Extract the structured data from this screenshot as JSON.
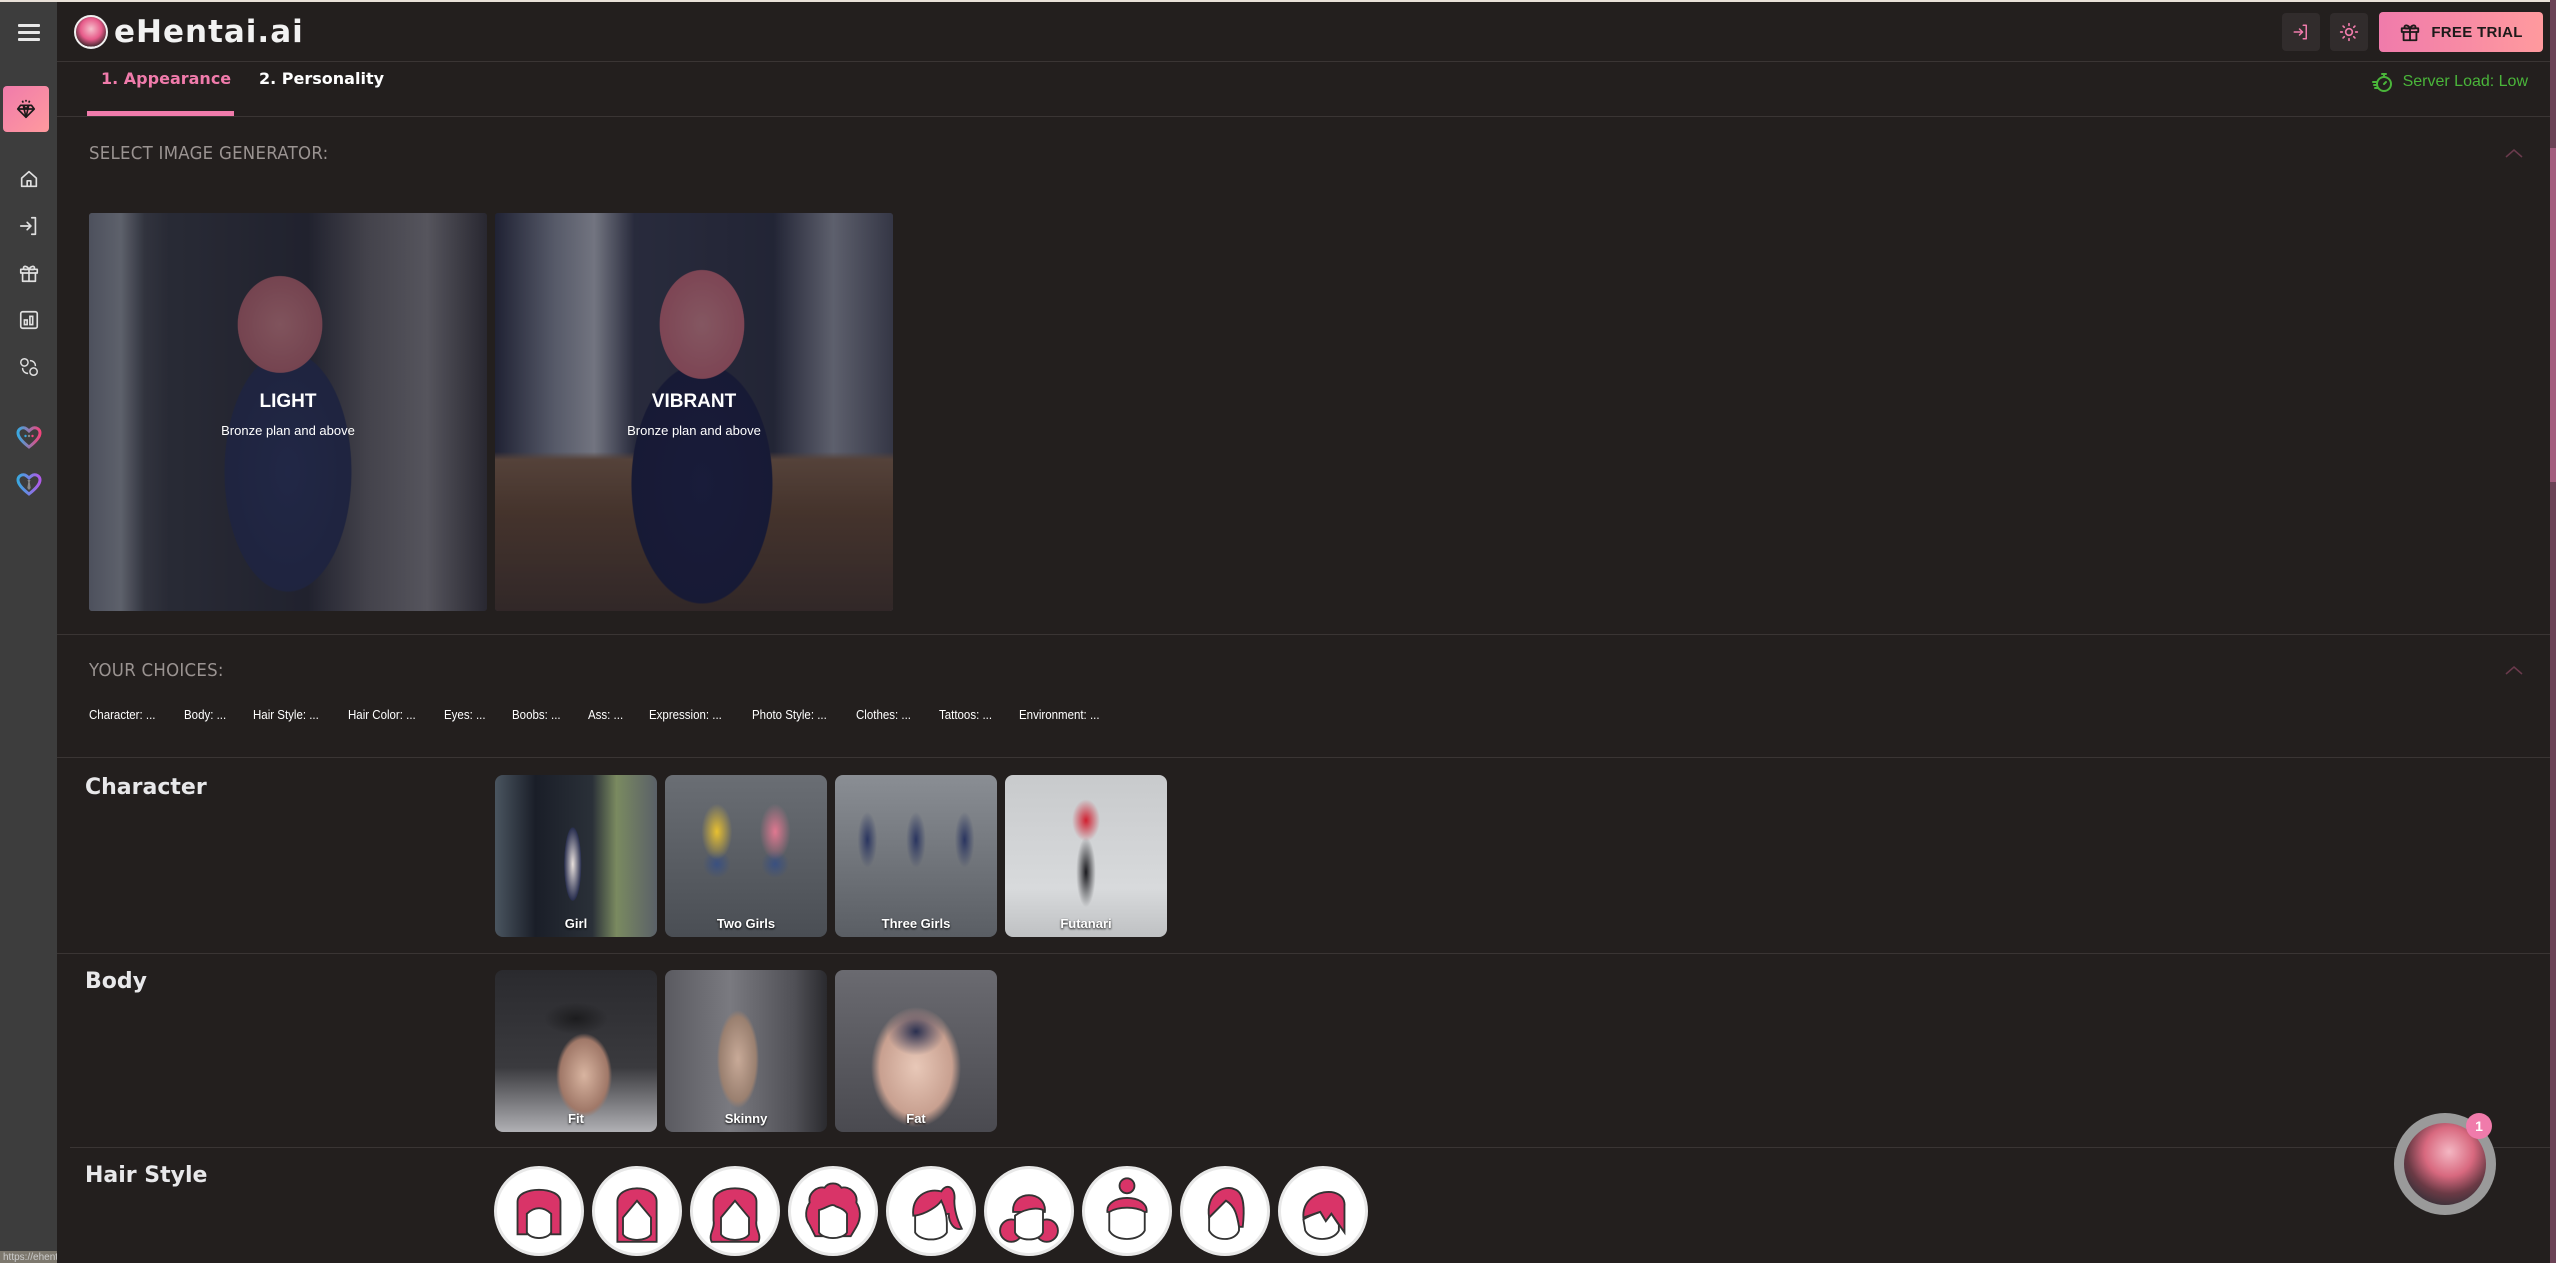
{
  "app": {
    "title": "eHentai.ai",
    "url_tooltip": "https://ehentai.ai"
  },
  "topbar": {
    "login_icon": "login-icon",
    "theme_icon": "sun-icon",
    "free_trial_label": "FREE TRIAL"
  },
  "sidebar": {
    "items": [
      {
        "name": "premium",
        "icon": "diamond-icon",
        "active": true
      },
      {
        "name": "home",
        "icon": "home-icon"
      },
      {
        "name": "login",
        "icon": "login-icon"
      },
      {
        "name": "gift",
        "icon": "gift-icon"
      },
      {
        "name": "stats",
        "icon": "chart-icon"
      },
      {
        "name": "exchange",
        "icon": "users-exchange-icon"
      },
      {
        "name": "chat-heart",
        "icon": "heart-chat-icon"
      },
      {
        "name": "tie-heart",
        "icon": "heart-tie-icon"
      }
    ]
  },
  "tabs": [
    {
      "number": "1.",
      "label": "Appearance",
      "active": true
    },
    {
      "number": "2.",
      "label": "Personality",
      "active": false
    }
  ],
  "server_load": "Server Load: Low",
  "image_generator": {
    "heading": "SELECT IMAGE GENERATOR:",
    "options": [
      {
        "title": "LIGHT",
        "subtitle": "Bronze plan and above"
      },
      {
        "title": "VIBRANT",
        "subtitle": "Bronze plan and above"
      }
    ]
  },
  "choices": {
    "heading": "YOUR CHOICES:",
    "items": [
      "Character: ...",
      "Body: ...",
      "Hair Style: ...",
      "Hair Color: ...",
      "Eyes: ...",
      "Boobs: ...",
      "Ass: ...",
      "Expression: ...",
      "Photo Style: ...",
      "Clothes: ...",
      "Tattoos: ...",
      "Environment: ..."
    ]
  },
  "categories": {
    "character": {
      "title": "Character",
      "options": [
        "Girl",
        "Two Girls",
        "Three Girls",
        "Futanari"
      ]
    },
    "body": {
      "title": "Body",
      "options": [
        "Fit",
        "Skinny",
        "Fat"
      ]
    },
    "hair_style": {
      "title": "Hair Style",
      "option_count": 9
    }
  },
  "chat": {
    "badge_count": "1"
  },
  "colors": {
    "accent": "#f07bab",
    "accent_end": "#ff9a9e",
    "server_ok": "#4ab53a",
    "background": "#231f1e",
    "sidebar": "#3d3d3d",
    "hair_pink": "#d93468"
  }
}
